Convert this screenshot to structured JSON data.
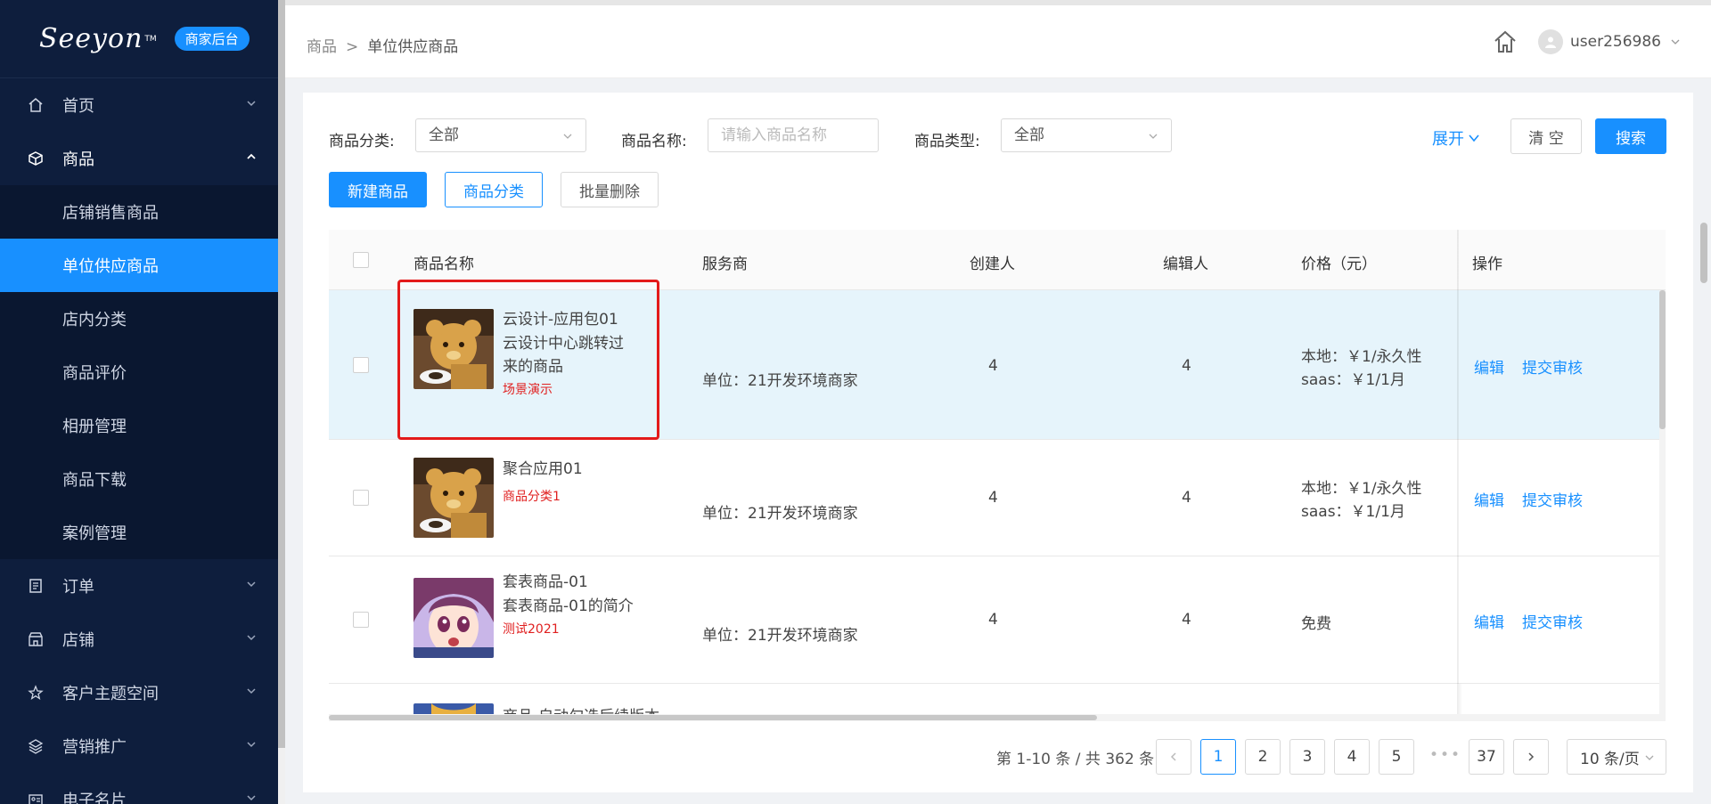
{
  "app": {
    "brand": "Seeyon",
    "badge": "商家后台"
  },
  "sidebar": {
    "items": [
      {
        "label": "首页",
        "icon": "home-icon"
      },
      {
        "label": "商品",
        "icon": "cube-icon",
        "open": true,
        "children": [
          "店铺销售商品",
          "单位供应商品",
          "店内分类",
          "商品评价",
          "相册管理",
          "商品下载",
          "案例管理"
        ],
        "active_child": "单位供应商品"
      },
      {
        "label": "订单",
        "icon": "order-icon"
      },
      {
        "label": "店铺",
        "icon": "shop-icon"
      },
      {
        "label": "客户主题空间",
        "icon": "star-icon"
      },
      {
        "label": "营销推广",
        "icon": "layers-icon"
      },
      {
        "label": "电子名片",
        "icon": "card-icon"
      }
    ]
  },
  "header": {
    "breadcrumb": [
      "商品",
      "单位供应商品"
    ],
    "breadcrumb_sep": ">",
    "username": "user256986"
  },
  "filters": {
    "category_label": "商品分类:",
    "category_value": "全部",
    "name_label": "商品名称:",
    "name_placeholder": "请输入商品名称",
    "type_label": "商品类型:",
    "type_value": "全部",
    "expand_label": "展开",
    "clear_label": "清 空",
    "search_label": "搜索"
  },
  "toolbar": {
    "new_label": "新建商品",
    "category_label": "商品分类",
    "batch_delete_label": "批量删除"
  },
  "table": {
    "columns": [
      "商品名称",
      "服务商",
      "创建人",
      "编辑人",
      "价格（元）",
      "操作"
    ],
    "rows": [
      {
        "name": "云设计-应用包01",
        "desc": "云设计中心跳转过来的商品",
        "tag": "场景演示",
        "provider": "单位：21开发环境商家",
        "creator": "4",
        "editor": "4",
        "price_line1": "本地：￥1/永久性",
        "price_line2": "saas：￥1/1月",
        "ops": [
          "编辑",
          "提交审核"
        ],
        "image": "bear"
      },
      {
        "name": "聚合应用01",
        "desc": "",
        "tag": "商品分类1",
        "provider": "单位：21开发环境商家",
        "creator": "4",
        "editor": "4",
        "price_line1": "本地：￥1/永久性",
        "price_line2": "saas：￥1/1月",
        "ops": [
          "编辑",
          "提交审核"
        ],
        "image": "bear"
      },
      {
        "name": "套表商品-01",
        "desc": "套表商品-01的简介",
        "tag": "测试2021",
        "provider": "单位：21开发环境商家",
        "creator": "4",
        "editor": "4",
        "price_line1": "免费",
        "price_line2": "",
        "ops": [
          "编辑",
          "提交审核"
        ],
        "image": "anime-girl"
      },
      {
        "name": "商品-自动勾选后续版本",
        "image": "anime-blue"
      }
    ]
  },
  "pagination": {
    "info": "第 1-10 条 / 共 362 条",
    "pages": [
      "1",
      "2",
      "3",
      "4",
      "5"
    ],
    "ellipsis": "•••",
    "last_page": "37",
    "current": "1",
    "page_size": "10 条/页"
  },
  "colors": {
    "primary": "#1890ff",
    "sidebar_bg": "#0e1e3d",
    "highlight_row": "#e6f4fb",
    "tag_red": "#e02020",
    "annotation_red": "#e31a1a"
  }
}
